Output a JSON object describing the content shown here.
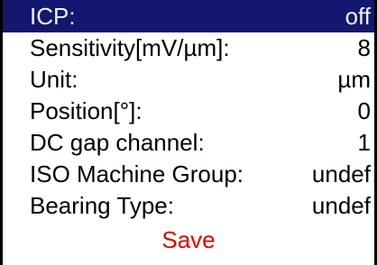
{
  "menu": {
    "items": [
      {
        "label": "ICP:",
        "value": "off",
        "selected": true
      },
      {
        "label": "Sensitivity[mV/µm]:",
        "value": "8"
      },
      {
        "label": "Unit:",
        "value": "µm"
      },
      {
        "label": "Position[°]:",
        "value": "0"
      },
      {
        "label": "DC gap channel:",
        "value": "1"
      },
      {
        "label": "ISO Machine Group:",
        "value": "undef"
      },
      {
        "label": "Bearing Type:",
        "value": "undef"
      }
    ],
    "save_label": "Save"
  },
  "colors": {
    "highlight_bg": "#13176f",
    "highlight_text": "#f2f2f2",
    "save_text": "#e00000"
  }
}
